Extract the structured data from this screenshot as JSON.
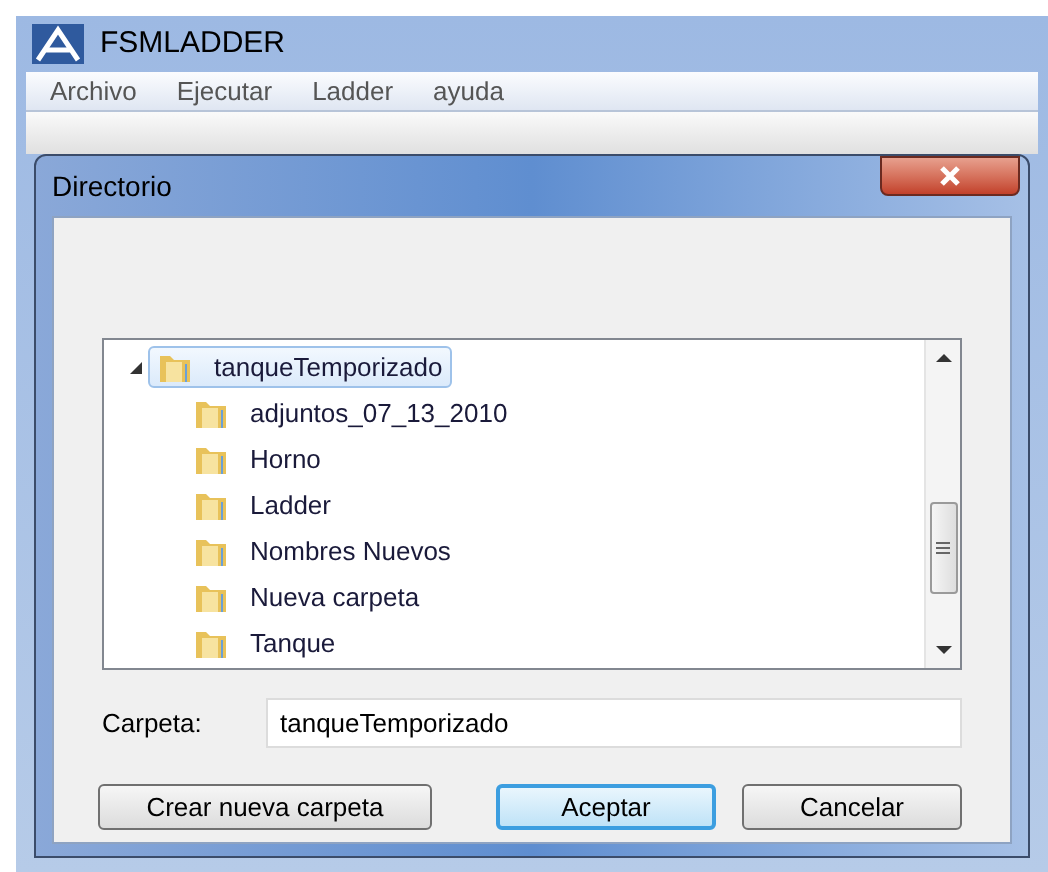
{
  "window": {
    "title": "FSMLADDER"
  },
  "menu": [
    "Archivo",
    "Ejecutar",
    "Ladder",
    "ayuda"
  ],
  "dialog": {
    "title": "Directorio",
    "tree": [
      {
        "label": "tanqueTemporizado",
        "expanded": true,
        "selected": true,
        "children": [
          {
            "label": "adjuntos_07_13_2010",
            "selected": false
          },
          {
            "label": "Horno",
            "selected": false
          },
          {
            "label": "Ladder",
            "selected": false
          },
          {
            "label": "Nombres Nuevos",
            "selected": false
          },
          {
            "label": "Nueva carpeta",
            "selected": false
          },
          {
            "label": "Tanque",
            "selected": false
          }
        ]
      }
    ],
    "folder_label": "Carpeta:",
    "folder_value": "tanqueTemporizado",
    "buttons": [
      {
        "label": "Crear nueva carpeta",
        "default": false
      },
      {
        "label": "Aceptar",
        "default": true
      },
      {
        "label": "Cancelar",
        "default": false
      }
    ]
  }
}
